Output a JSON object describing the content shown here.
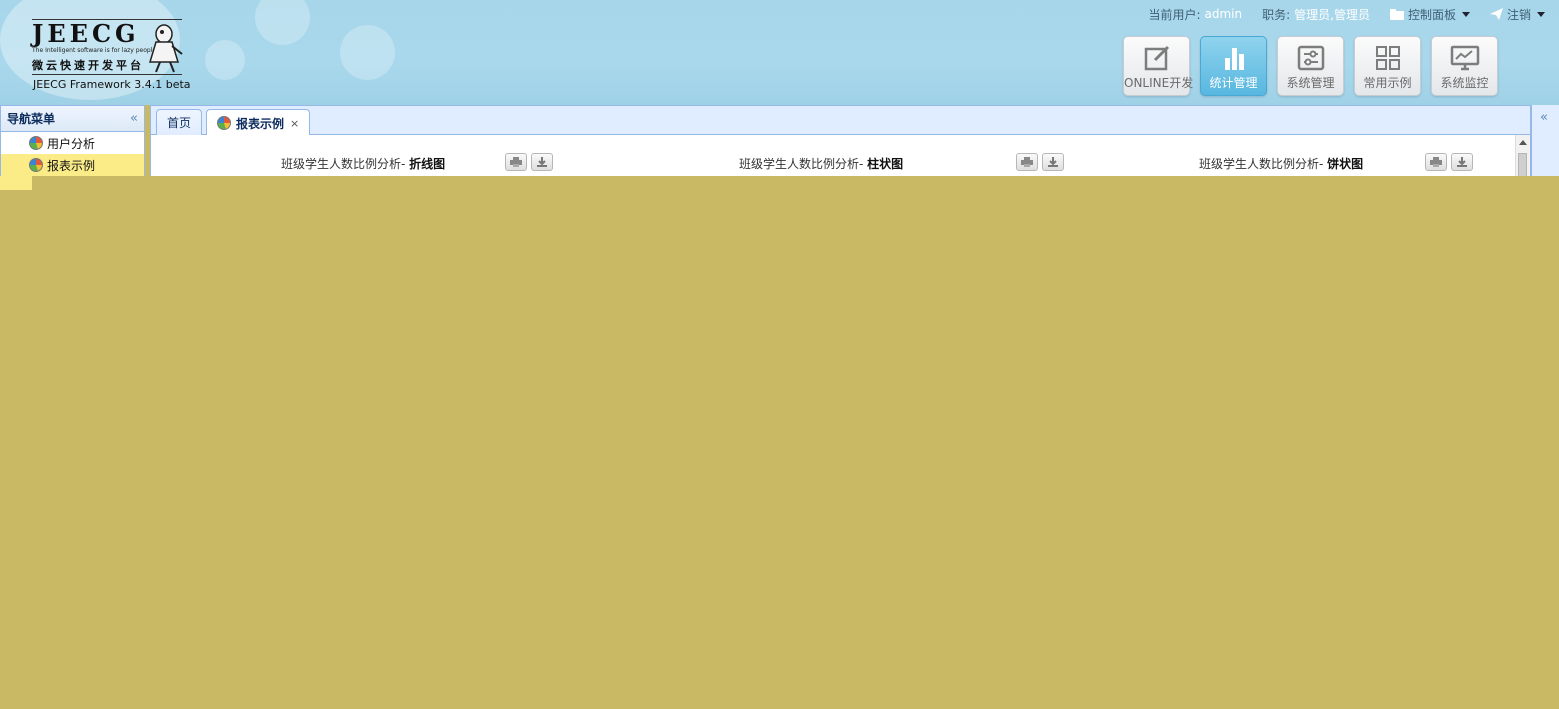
{
  "header": {
    "logo_title": "JEECG",
    "logo_tagline": "The Intelligent software is for lazy people",
    "logo_cn": "微云快速开发平台",
    "version": "JEECG Framework 3.4.1 beta",
    "user_label": "当前用户:",
    "user_value": "admin",
    "role_label": "职务:",
    "role_value": "管理员,管理员",
    "control_panel": "控制面板",
    "logout": "注销"
  },
  "modules": [
    {
      "label": "ONLINE开发",
      "icon": "edit-icon",
      "active": false
    },
    {
      "label": "统计管理",
      "icon": "bar-chart-icon",
      "active": true
    },
    {
      "label": "系统管理",
      "icon": "settings-sliders-icon",
      "active": false
    },
    {
      "label": "常用示例",
      "icon": "grid-icon",
      "active": false
    },
    {
      "label": "系统监控",
      "icon": "monitor-icon",
      "active": false
    }
  ],
  "nav": {
    "title": "导航菜单",
    "items": [
      {
        "label": "用户分析"
      },
      {
        "label": "报表示例"
      }
    ]
  },
  "tabs": [
    {
      "label": "首页"
    },
    {
      "label": "报表示例"
    }
  ],
  "charts": [
    {
      "title_prefix": "班级学生人数比例分析- ",
      "title_bold": "折线图"
    },
    {
      "title_prefix": "班级学生人数比例分析- ",
      "title_bold": "柱状图"
    },
    {
      "title_prefix": "班级学生人数比例分析- ",
      "title_bold": "饼状图"
    }
  ],
  "colors": {
    "accent": "#58b7df",
    "header_bg": "#a9d8ec",
    "panel_border": "#95b8e7",
    "overlay": "#c9b964",
    "selected": "#fbec88"
  }
}
